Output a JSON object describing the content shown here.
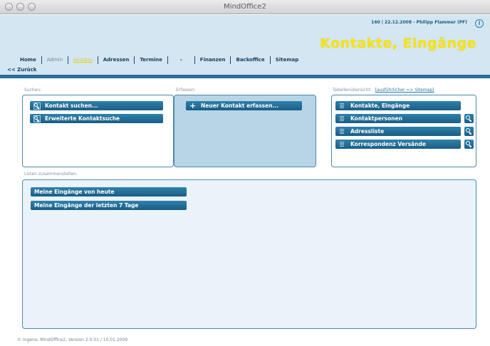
{
  "window": {
    "title": "MindOffice2"
  },
  "header": {
    "user_info": "160 | 22.12.2008 - Philipp Flammer (PF)",
    "page_title": "Kontakte, Eingänge",
    "back_link": "<< Zurück",
    "nav": [
      {
        "label": "Home",
        "state": "normal"
      },
      {
        "label": "Admin",
        "state": "dim"
      },
      {
        "label": "Kontakte",
        "state": "active"
      },
      {
        "label": "Adressen",
        "state": "normal"
      },
      {
        "label": "Termine",
        "state": "normal"
      },
      {
        "label": "-",
        "state": "normal"
      },
      {
        "label": "Finanzen",
        "state": "normal"
      },
      {
        "label": "Backoffice",
        "state": "normal"
      },
      {
        "label": "Sitemap",
        "state": "normal"
      }
    ]
  },
  "search": {
    "label": "Suchen:",
    "buttons": [
      "Kontakt suchen...",
      "Erweiterte Kontaktsuche"
    ]
  },
  "create": {
    "label": "Erfassen:",
    "button": "Neuer Kontakt erfassen..."
  },
  "tables": {
    "label": "Tabellenübersicht:",
    "link": "[ausführlicher => Sitemap]",
    "items": [
      "Kontakte, Eingänge",
      "Kontaktpersonen",
      "Adressliste",
      "Korrespondenz Versände"
    ]
  },
  "lists": {
    "label": "Listen zusammenstellen:",
    "items": [
      "Meine Eingänge von heute",
      "Meine Eingänge der letzten 7 Tage"
    ]
  },
  "footer": "© Ingeno, MindOffice2, Version 2.0.01 / 10.01.2009",
  "colors": {
    "accent": "#1a5d85",
    "title_yellow": "#f6e21c",
    "header_bg": "#d3e6f2",
    "panel_bg": "#eaf3f9"
  }
}
